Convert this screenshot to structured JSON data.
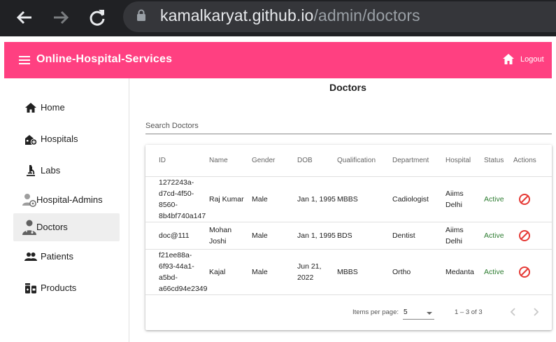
{
  "browser": {
    "url_host": "kamalkaryat.github.io",
    "url_path": "/admin/doctors",
    "back_icon": "arrow-left-icon",
    "forward_icon": "arrow-right-icon",
    "reload_icon": "reload-icon",
    "lock_icon": "lock-icon"
  },
  "appbar": {
    "title": "Online-Hospital-Services",
    "logout_label": "Logout",
    "color": "#ff4081"
  },
  "sidebar": {
    "items": [
      {
        "label": "Home",
        "icon": "home-icon"
      },
      {
        "label": "Hospitals",
        "icon": "hospital-icon"
      },
      {
        "label": "Labs",
        "icon": "microscope-icon"
      },
      {
        "label": "Hospital-Admins",
        "icon": "user-settings-icon"
      },
      {
        "label": "Doctors",
        "icon": "doctor-icon",
        "active": true
      },
      {
        "label": "Patients",
        "icon": "people-icon"
      },
      {
        "label": "Products",
        "icon": "medication-icon"
      }
    ]
  },
  "main": {
    "page_title": "Doctors",
    "search_placeholder": "Search Doctors"
  },
  "table": {
    "headers": [
      "ID",
      "Name",
      "Gender",
      "DOB",
      "Qualification",
      "Department",
      "Hospital",
      "Status",
      "Actions"
    ],
    "rows": [
      {
        "id_lines": [
          "1272243a-",
          "d7cd-4f50-",
          "8560-",
          "8b4bf740a147"
        ],
        "name_lines": [
          "Raj Kumar"
        ],
        "gender": "Male",
        "dob_lines": [
          "Jan 1, 1995"
        ],
        "qualification": "MBBS",
        "department": "Cadiologist",
        "hospital_lines": [
          "Aiims",
          "Delhi"
        ],
        "status": "Active",
        "action_icon": "block-icon"
      },
      {
        "id_lines": [
          "doc@111"
        ],
        "name_lines": [
          "Mohan",
          "Joshi"
        ],
        "gender": "Male",
        "dob_lines": [
          "Jan 1, 1995"
        ],
        "qualification": "BDS",
        "department": "Dentist",
        "hospital_lines": [
          "Aiims",
          "Delhi"
        ],
        "status": "Active",
        "action_icon": "block-icon"
      },
      {
        "id_lines": [
          "f21ee88a-",
          "6f93-44a1-",
          "a5bd-",
          "a66cd94e2349"
        ],
        "name_lines": [
          "Kajal"
        ],
        "gender": "Male",
        "dob_lines": [
          "Jun 21,",
          "2022"
        ],
        "qualification": "MBBS",
        "department": "Ortho",
        "hospital_lines": [
          "Medanta"
        ],
        "status": "Active",
        "action_icon": "block-icon"
      }
    ],
    "status_color": "#2e7d32",
    "action_color": "#e53935"
  },
  "paginator": {
    "items_per_page_label": "Items per page:",
    "page_size": "5",
    "range_label": "1 – 3 of 3"
  }
}
